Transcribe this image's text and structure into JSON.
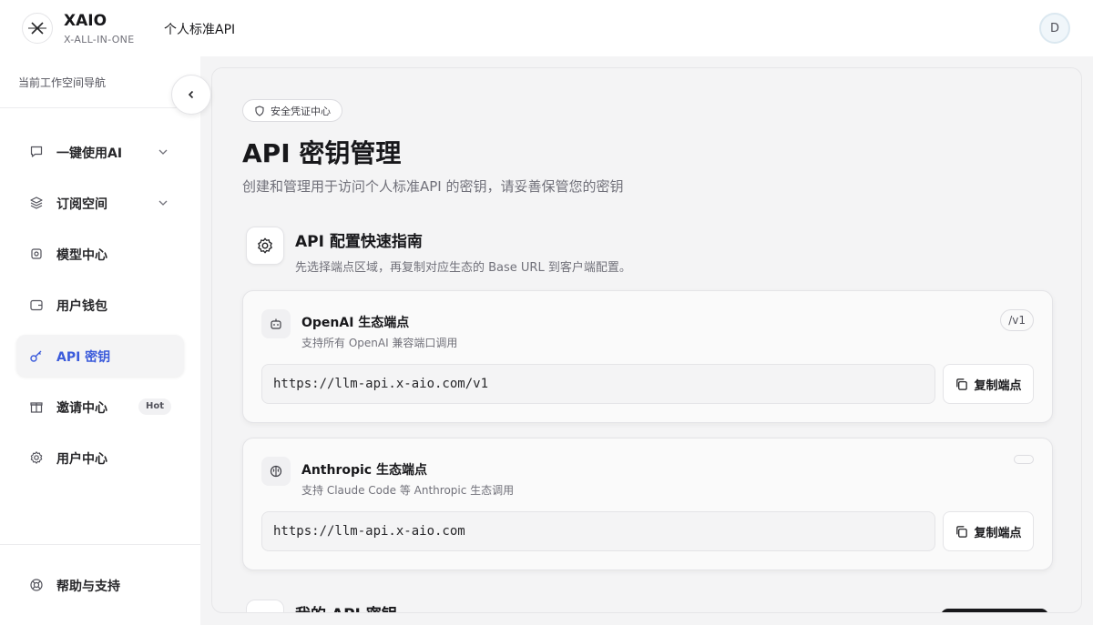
{
  "header": {
    "brand_name": "XAIO",
    "brand_sub": "X-ALL-IN-ONE",
    "title": "个人标准API",
    "avatar_letter": "D"
  },
  "sidebar": {
    "heading": "当前工作空间导航",
    "items": [
      {
        "label": "一键使用AI",
        "icon": "chat-bubble-icon",
        "has_chevron": true
      },
      {
        "label": "订阅空间",
        "icon": "layers-icon",
        "has_chevron": true
      },
      {
        "label": "模型中心",
        "icon": "cpu-icon"
      },
      {
        "label": "用户钱包",
        "icon": "wallet-icon"
      },
      {
        "label": "API 密钥",
        "icon": "key-icon",
        "active": true
      },
      {
        "label": "邀请中心",
        "icon": "gift-icon",
        "badge": "Hot"
      },
      {
        "label": "用户中心",
        "icon": "gear-icon"
      }
    ],
    "footer_item": {
      "label": "帮助与支持",
      "icon": "lifebuoy-icon"
    }
  },
  "main": {
    "pill_label": "安全凭证中心",
    "title": "API 密钥管理",
    "description": "创建和管理用于访问个人标准API 的密钥，请妥善保管您的密钥",
    "guide": {
      "title": "API 配置快速指南",
      "description": "先选择端点区域，再复制对应生态的 Base URL 到客户端配置。"
    },
    "endpoints": [
      {
        "title": "OpenAI 生态端点",
        "description": "支持所有 OpenAI 兼容端口调用",
        "tag": "/v1",
        "url": "https://llm-api.x-aio.com/v1",
        "copy_label": "复制端点"
      },
      {
        "title": "Anthropic 生态端点",
        "description": "支持 Claude Code 等 Anthropic 生态调用",
        "tag": "",
        "url": "https://llm-api.x-aio.com",
        "copy_label": "复制端点"
      }
    ],
    "section2_title": "我的 API 密钥"
  },
  "colors": {
    "accent": "#3b5bdb",
    "dark": "#18181b",
    "muted": "#71717a"
  }
}
